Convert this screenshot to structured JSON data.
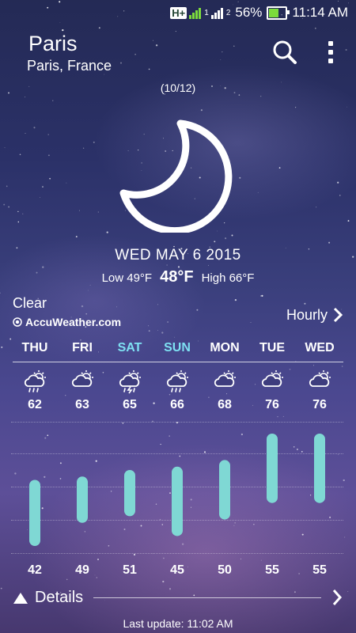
{
  "status_bar": {
    "network": "H+",
    "sim1": "1",
    "sim2": "2",
    "battery": "56%",
    "battery_level": 0.56,
    "time": "11:14 AM"
  },
  "header": {
    "city": "Paris",
    "location": "Paris, France",
    "search_icon": "search-icon",
    "menu_icon": "more-vert-icon"
  },
  "page_indicator": "(10/12)",
  "current": {
    "icon": "moon-icon",
    "date": "WED MAY 6 2015",
    "low": "Low 49°F",
    "temp": "48°F",
    "high": "High 66°F",
    "condition": "Clear"
  },
  "provider": "AccuWeather.com",
  "hourly_label": "Hourly",
  "forecast": [
    {
      "day": "THU",
      "icon": "cloud-sun-rain-icon",
      "high": "62",
      "low": "42",
      "weekend": false
    },
    {
      "day": "FRI",
      "icon": "cloud-sun-icon",
      "high": "63",
      "low": "49",
      "weekend": false
    },
    {
      "day": "SAT",
      "icon": "cloud-sun-thunder-icon",
      "high": "65",
      "low": "51",
      "weekend": true
    },
    {
      "day": "SUN",
      "icon": "cloud-sun-rain-icon",
      "high": "66",
      "low": "45",
      "weekend": true
    },
    {
      "day": "MON",
      "icon": "cloud-sun-icon",
      "high": "68",
      "low": "50",
      "weekend": false
    },
    {
      "day": "TUE",
      "icon": "cloud-sun-icon",
      "high": "76",
      "low": "55",
      "weekend": false
    },
    {
      "day": "WED",
      "icon": "cloud-sun-icon",
      "high": "76",
      "low": "55",
      "weekend": false
    }
  ],
  "details_label": "Details",
  "last_update": "Last update: 11:02 AM",
  "colors": {
    "bar": "#7fd8d4",
    "weekend_day": "#7ee0f2"
  }
}
